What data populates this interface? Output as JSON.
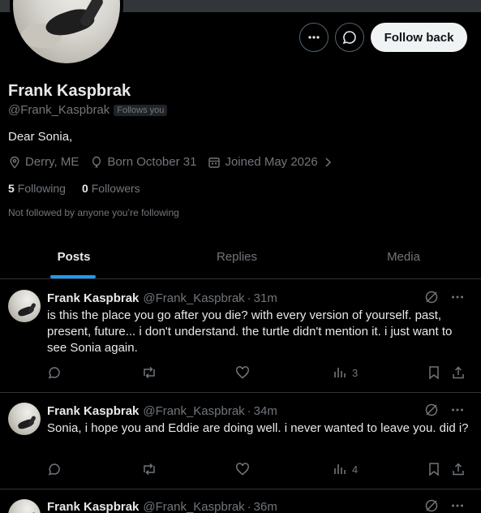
{
  "profile": {
    "name": "Frank Kaspbrak",
    "handle": "@Frank_Kaspbrak",
    "follows_you_badge": "Follows you",
    "bio": "Dear Sonia,",
    "location": "Derry, ME",
    "birthday": "Born October 31",
    "joined": "Joined May 2026",
    "following_count": "5",
    "following_label": "Following",
    "followers_count": "0",
    "followers_label": "Followers",
    "not_followed_text": "Not followed by anyone you’re following",
    "follow_button_label": "Follow back"
  },
  "tabs": [
    {
      "label": "Posts",
      "active": true
    },
    {
      "label": "Replies",
      "active": false
    },
    {
      "label": "Media",
      "active": false
    }
  ],
  "tweets": [
    {
      "name": "Frank Kaspbrak",
      "handle": "@Frank_Kaspbrak",
      "dot": "·",
      "time": "31m",
      "text": "is this the place you go after you die? with every version of yourself. past, present, future... i don't understand. the turtle didn't mention it. i just want to see Sonia again.",
      "views": "3"
    },
    {
      "name": "Frank Kaspbrak",
      "handle": "@Frank_Kaspbrak",
      "dot": "·",
      "time": "34m",
      "text": "Sonia, i hope you and Eddie are doing well. i never wanted to leave you. did i?",
      "views": "4"
    },
    {
      "name": "Frank Kaspbrak",
      "handle": "@Frank_Kaspbrak",
      "dot": "·",
      "time": "36m"
    }
  ],
  "colors": {
    "background": "#000000",
    "text_primary": "#e7e9ea",
    "text_secondary": "#71767b",
    "accent": "#1d9bf0",
    "border": "#2f3336"
  }
}
